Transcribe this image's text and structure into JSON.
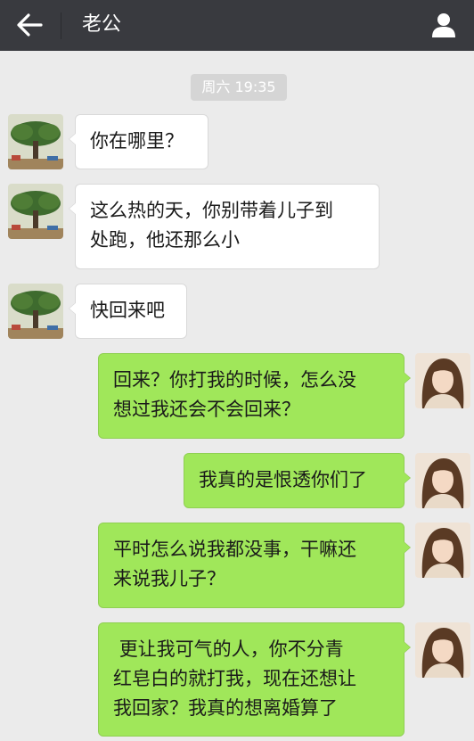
{
  "header": {
    "title": "老公",
    "back_icon": "arrow-left-icon",
    "profile_icon": "person-icon",
    "background": "#393a3f"
  },
  "timestamp": "周六 19:35",
  "messages": [
    {
      "side": "incoming",
      "text": "你在哪里？"
    },
    {
      "side": "incoming",
      "text": "这么热的天，你别带着儿子到\n处跑，他还那么小"
    },
    {
      "side": "incoming",
      "text": "快回来吧"
    },
    {
      "side": "outgoing",
      "text": "回来？你打我的时候，怎么没\n想过我还会不会回来？"
    },
    {
      "side": "outgoing",
      "text": "我真的是恨透你们了"
    },
    {
      "side": "outgoing",
      "text": "平时怎么说我都没事，干嘛还\n来说我儿子？"
    },
    {
      "side": "outgoing",
      "text": " 更让我可气的人，你不分青\n红皂白的就打我，现在还想让\n我回家？我真的想离婚算了"
    }
  ],
  "colors": {
    "background": "#ebebeb",
    "incoming_bubble": "#ffffff",
    "outgoing_bubble": "#a0e75a"
  }
}
